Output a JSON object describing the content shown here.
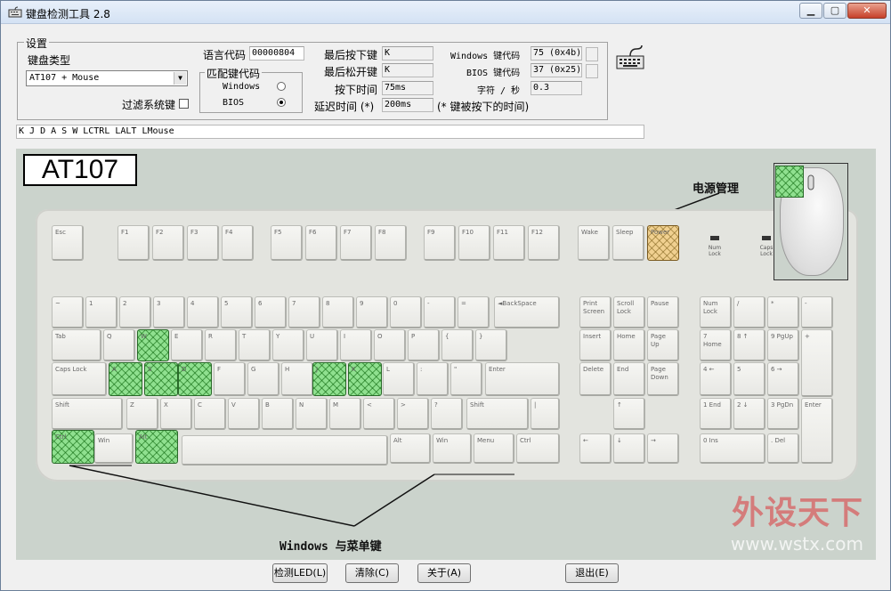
{
  "window": {
    "title": "键盘检测工具 2.8",
    "controls": {
      "minimize": "▁",
      "maximize": "▢",
      "close": "✕"
    }
  },
  "settings": {
    "group_title": "设置",
    "keyboard_type_label": "键盘类型",
    "keyboard_type_value": "AT107 + Mouse",
    "filter_system_keys_label": "过滤系统键",
    "filter_system_keys_checked": false,
    "language_code_label": "语言代码",
    "language_code_value": "00000804",
    "match_code_group": "匹配键代码",
    "match_windows_label": "Windows",
    "match_bios_label": "BIOS",
    "match_selected": "BIOS",
    "last_pressed_label": "最后按下键",
    "last_pressed_value": "K",
    "last_released_label": "最后松开键",
    "last_released_value": "K",
    "press_time_label": "按下时间",
    "press_time_value": "75ms",
    "delay_time_label": "延迟时间 (*)",
    "delay_time_value": "200ms",
    "delay_note": "(* 键被按下的时间)",
    "windows_code_label": "Windows 键代码",
    "windows_code_value": "75 (0x4b)",
    "bios_code_label": "BIOS 键代码",
    "bios_code_value": "37 (0x25)",
    "chars_per_sec_label": "字符 / 秒",
    "chars_per_sec_value": "0.3"
  },
  "log": {
    "text": "K J D A S W LCTRL LALT LMouse"
  },
  "keyboard": {
    "model": "AT107",
    "annotation_power": "电源管理",
    "annotation_windows": "Windows 与菜单键",
    "keys": {
      "esc": "Esc",
      "f1": "F1",
      "f2": "F2",
      "f3": "F3",
      "f4": "F4",
      "f5": "F5",
      "f6": "F6",
      "f7": "F7",
      "f8": "F8",
      "f9": "F9",
      "f10": "F10",
      "f11": "F11",
      "f12": "F12",
      "wake": "Wake",
      "sleep": "Sleep",
      "power": "Power",
      "tilde": "~",
      "n1": "1",
      "n2": "2",
      "n3": "3",
      "n4": "4",
      "n5": "5",
      "n6": "6",
      "n7": "7",
      "n8": "8",
      "n9": "9",
      "n0": "0",
      "minus": "-",
      "equal": "=",
      "backspace": "◄BackSpace",
      "tab": "Tab",
      "q": "Q",
      "w": "W",
      "e": "E",
      "r": "R",
      "t": "T",
      "y": "Y",
      "u": "U",
      "i": "I",
      "o": "O",
      "p": "P",
      "lbracket": "{",
      "rbracket": "}",
      "caps": "Caps Lock",
      "a": "A",
      "s": "S",
      "d": "D",
      "f": "F",
      "g": "G",
      "h": "H",
      "j": "J",
      "k": "K",
      "l": "L",
      "semicolon": ":",
      "quote": "\"",
      "enter": "Enter",
      "lshift": "Shift",
      "z": "Z",
      "x": "X",
      "c": "C",
      "v": "V",
      "b": "B",
      "n": "N",
      "m": "M",
      "comma": "<",
      "period": ">",
      "slash": "?",
      "rshift": "Shift",
      "backslash": "|",
      "lctrl": "Ctrl",
      "lwin": "Win",
      "lalt": "Alt",
      "space": "",
      "ralt": "Alt",
      "rwin": "Win",
      "menu": "Menu",
      "rctrl": "Ctrl",
      "prtsc": "Print Screen",
      "scroll": "Scroll Lock",
      "pause": "Pause",
      "insert": "Insert",
      "home": "Home",
      "pgup": "Page Up",
      "delete": "Delete",
      "end": "End",
      "pgdn": "Page Down",
      "up": "↑",
      "left": "←",
      "down": "↓",
      "right": "→",
      "numlock": "Num Lock",
      "kpdiv": "/",
      "kpmul": "*",
      "kpsub": "-",
      "kp7": "7 Home",
      "kp8": "8 ↑",
      "kp9": "9 PgUp",
      "kpadd": "+",
      "kp4": "4 ←",
      "kp5": "5",
      "kp6": "6 →",
      "kp1": "1 End",
      "kp2": "2 ↓",
      "kp3": "3 PgDn",
      "kpenter": "Enter",
      "kp0": "0 Ins",
      "kpdot": ". Del"
    },
    "leds": {
      "num": "Num Lock",
      "caps": "Caps Lock",
      "scroll": "Scroll Lock"
    }
  },
  "watermark": {
    "brand": "外设天下",
    "url": "www.wstx.com"
  },
  "buttons": {
    "detect_led": "检测LED(L)",
    "clear": "清除(C)",
    "about": "关于(A)",
    "exit": "退出(E)"
  },
  "colors": {
    "highlight_pressed": "#8fe08f",
    "highlight_power": "#f0d090",
    "panel_bg": "#cbd3cc"
  }
}
